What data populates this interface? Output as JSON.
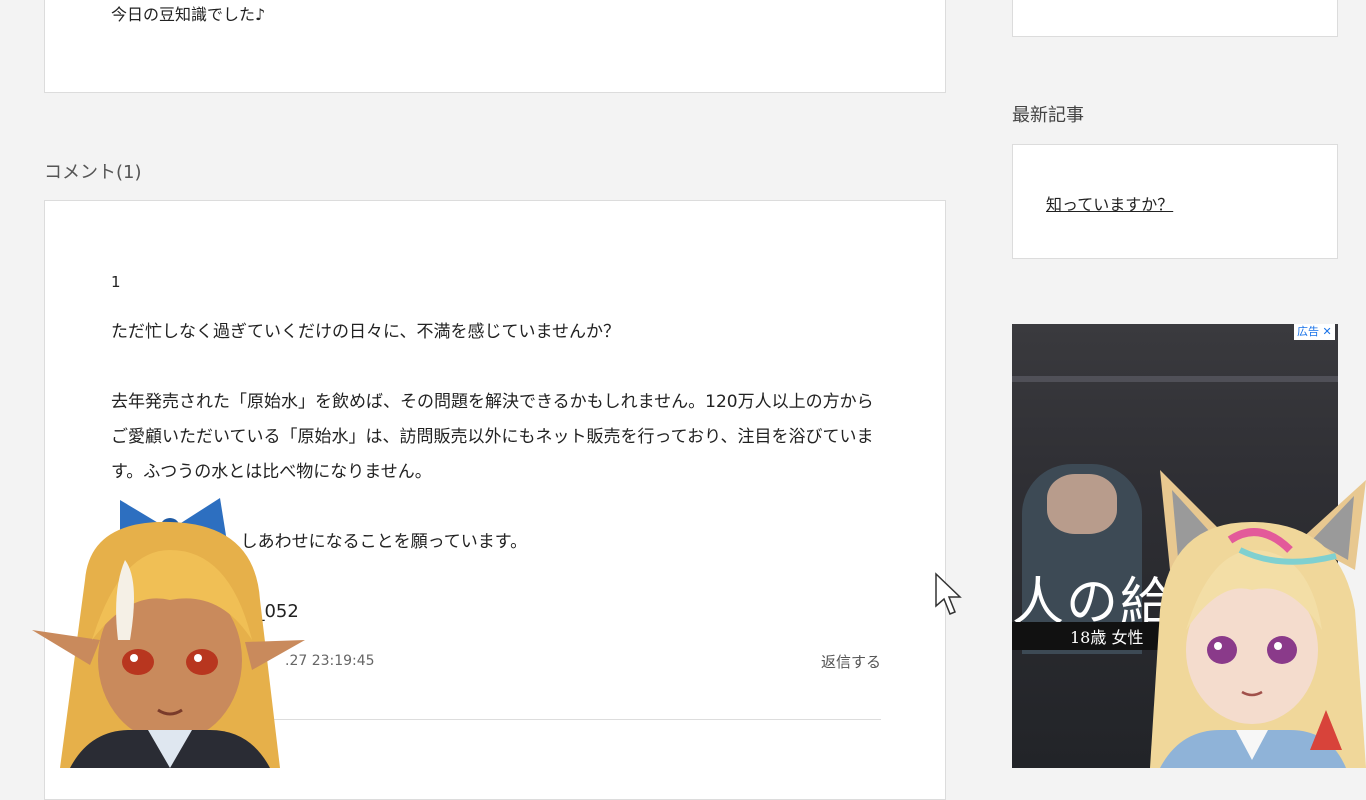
{
  "article": {
    "tail_text": "今日の豆知識でした♪"
  },
  "comments": {
    "heading": "コメント(1)",
    "items": [
      {
        "number": "1",
        "paragraphs": [
          "ただ忙しなく過ぎていくだけの日々に、不満を感じていませんか？",
          "去年発売された「原始水」を飲めば、その問題を解決できるかもしれません。120万人以上の方からご愛顧いただいている「原始水」は、訪問販売以外にもネット販売を行っており、注目を浴びています。ふつうの水とは比べ物になりません。",
          "が、しあわせになることを願っています。"
        ],
        "author": "na_052",
        "date": ".27 23:19:45",
        "reply_label": "返信する"
      }
    ]
  },
  "sidebar": {
    "latest_heading": "最新記事",
    "latest_items": [
      {
        "label": "知っていますか？"
      }
    ]
  },
  "ad": {
    "badge": "広告 ✕",
    "headline": "人の給",
    "subline": "18歳 女性"
  },
  "colors": {
    "background": "#f3f3f3",
    "card": "#ffffff",
    "border": "#dcdcdc",
    "ad_badge": "#1a73e8"
  },
  "icons": {
    "cursor": "mouse-pointer-icon",
    "ad_close": "close-icon"
  }
}
